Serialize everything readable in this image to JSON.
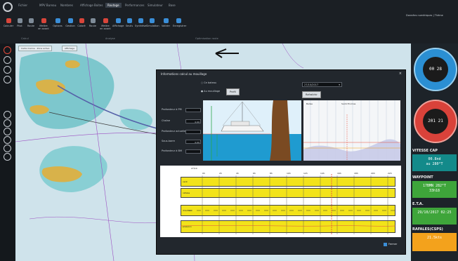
{
  "ribbon": {
    "tabs": [
      "Fichier",
      "MPV Bureau",
      "Nombres",
      "Affichage Boites",
      "Routage",
      "Performances",
      "Simulateur",
      "Base"
    ],
    "active_tab_index": 4,
    "tools": [
      "Calculer",
      "Pilot",
      "Route",
      "Mettre en avant",
      "Options",
      "Gestion",
      "Coloré",
      "Route",
      "Mettre en avant",
      "Affichage",
      "Seuils",
      "Synthèse",
      "Simulation",
      "Valider",
      "Enregistrer"
    ],
    "groups": [
      "Calcul",
      "Analyse",
      "Optimisation route"
    ],
    "top_right": "Données numériques  |  Thème"
  },
  "map": {
    "tab1": "Carte marine · Zone active",
    "tab2": "Affichage"
  },
  "dialog": {
    "title": "Informations calcul au mouillage",
    "radio1": "Ce bateau",
    "radio2": "Au mouillage",
    "profile_btn": "Profil",
    "date": "27/10/2017",
    "refresh_btn": "Rafraîchir",
    "labels": {
      "p1": "Profondeur à PM",
      "p2": "Chaîne",
      "p3": "Profondeur actuelle",
      "p4": "Sous-barre",
      "p5": "Profondeur à BM"
    },
    "fields": {
      "p2": "0.00",
      "p4": "0.00"
    },
    "tide_left": "Balise",
    "tide_right": "Saint-Thomas",
    "table_date": "27/10",
    "table_hours": [
      "0h",
      "2h",
      "4h",
      "6h",
      "8h",
      "10h",
      "12h",
      "14h",
      "16h",
      "18h",
      "20h",
      "22h"
    ],
    "table_row_labels": {
      "wind": "vent",
      "gust": "rafales",
      "dir": "direction",
      "press": "pression"
    },
    "close_label": "Fermer"
  },
  "right_panel": {
    "gauge1_value": "00 28",
    "gauge2_value": "201 21",
    "section1_title": "VITESSE CAP",
    "section1_line1": "00.8nd",
    "section1_line2": "au 280°T",
    "section2_title": "WAYPOINT",
    "section2_line1": "17BMN 282°T",
    "section2_line2": "33h18",
    "section3_title": "E.T.A.",
    "section3_line1": "29/10/2017 02:25",
    "section4_title": "RAFALES(CSPS)",
    "section4_line1": "21.5kts"
  },
  "colors": {
    "ribbon": "#1b1f24",
    "sea": "#cfe3eb",
    "shallow": "#6fc2c8",
    "land": "#d8b24a",
    "yellow": "#f2e31a",
    "teal_box": "#138a8a",
    "green_box": "#3ea53a",
    "orange_box": "#f3a21c"
  }
}
